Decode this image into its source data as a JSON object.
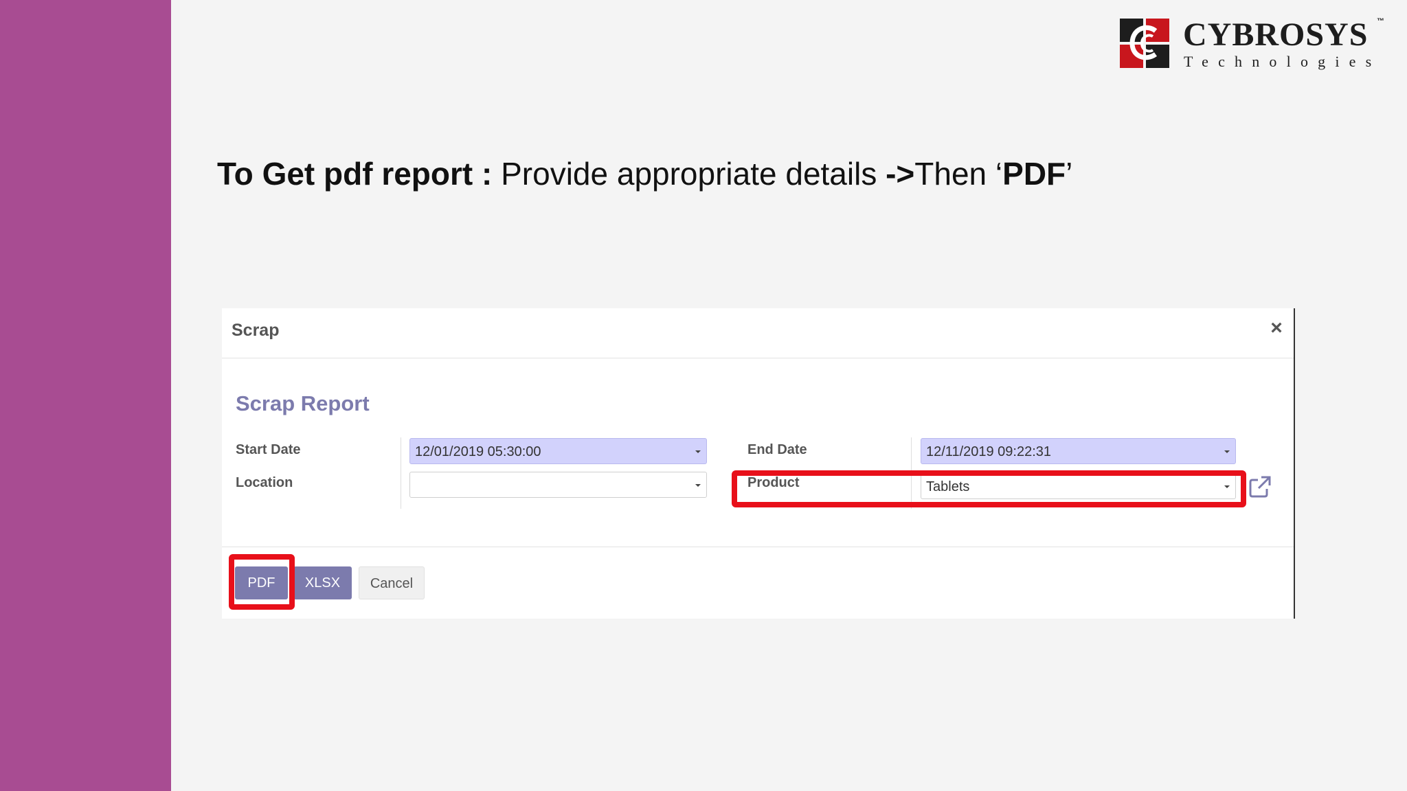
{
  "logo": {
    "name": "CYBROSYS",
    "tm": "™",
    "subtitle": "Technologies",
    "colors": {
      "red": "#c8161d",
      "dark": "#1d1d1d"
    }
  },
  "heading": {
    "bold_part": "To Get pdf report :",
    "normal_part": " Provide appropriate details ",
    "arrow": "->",
    "then": "Then ‘",
    "pdf": "PDF",
    "close_quote": "’"
  },
  "dialog": {
    "title": "Scrap",
    "close_icon": "×",
    "report_title": "Scrap Report",
    "fields": {
      "start_date": {
        "label": "Start Date",
        "value": "12/01/2019 05:30:00"
      },
      "location": {
        "label": "Location",
        "value": ""
      },
      "end_date": {
        "label": "End Date",
        "value": "12/11/2019 09:22:31"
      },
      "product": {
        "label": "Product",
        "value": "Tablets"
      }
    },
    "buttons": {
      "pdf": "PDF",
      "xlsx": "XLSX",
      "cancel": "Cancel"
    },
    "icons": {
      "dropdown": "caret-down-icon",
      "external": "external-link-icon",
      "close": "close-icon"
    }
  },
  "colors": {
    "sidebar": "#a84c92",
    "accent": "#7c7bad",
    "highlight": "#e8101a",
    "filled_field": "#d2d2fc"
  }
}
